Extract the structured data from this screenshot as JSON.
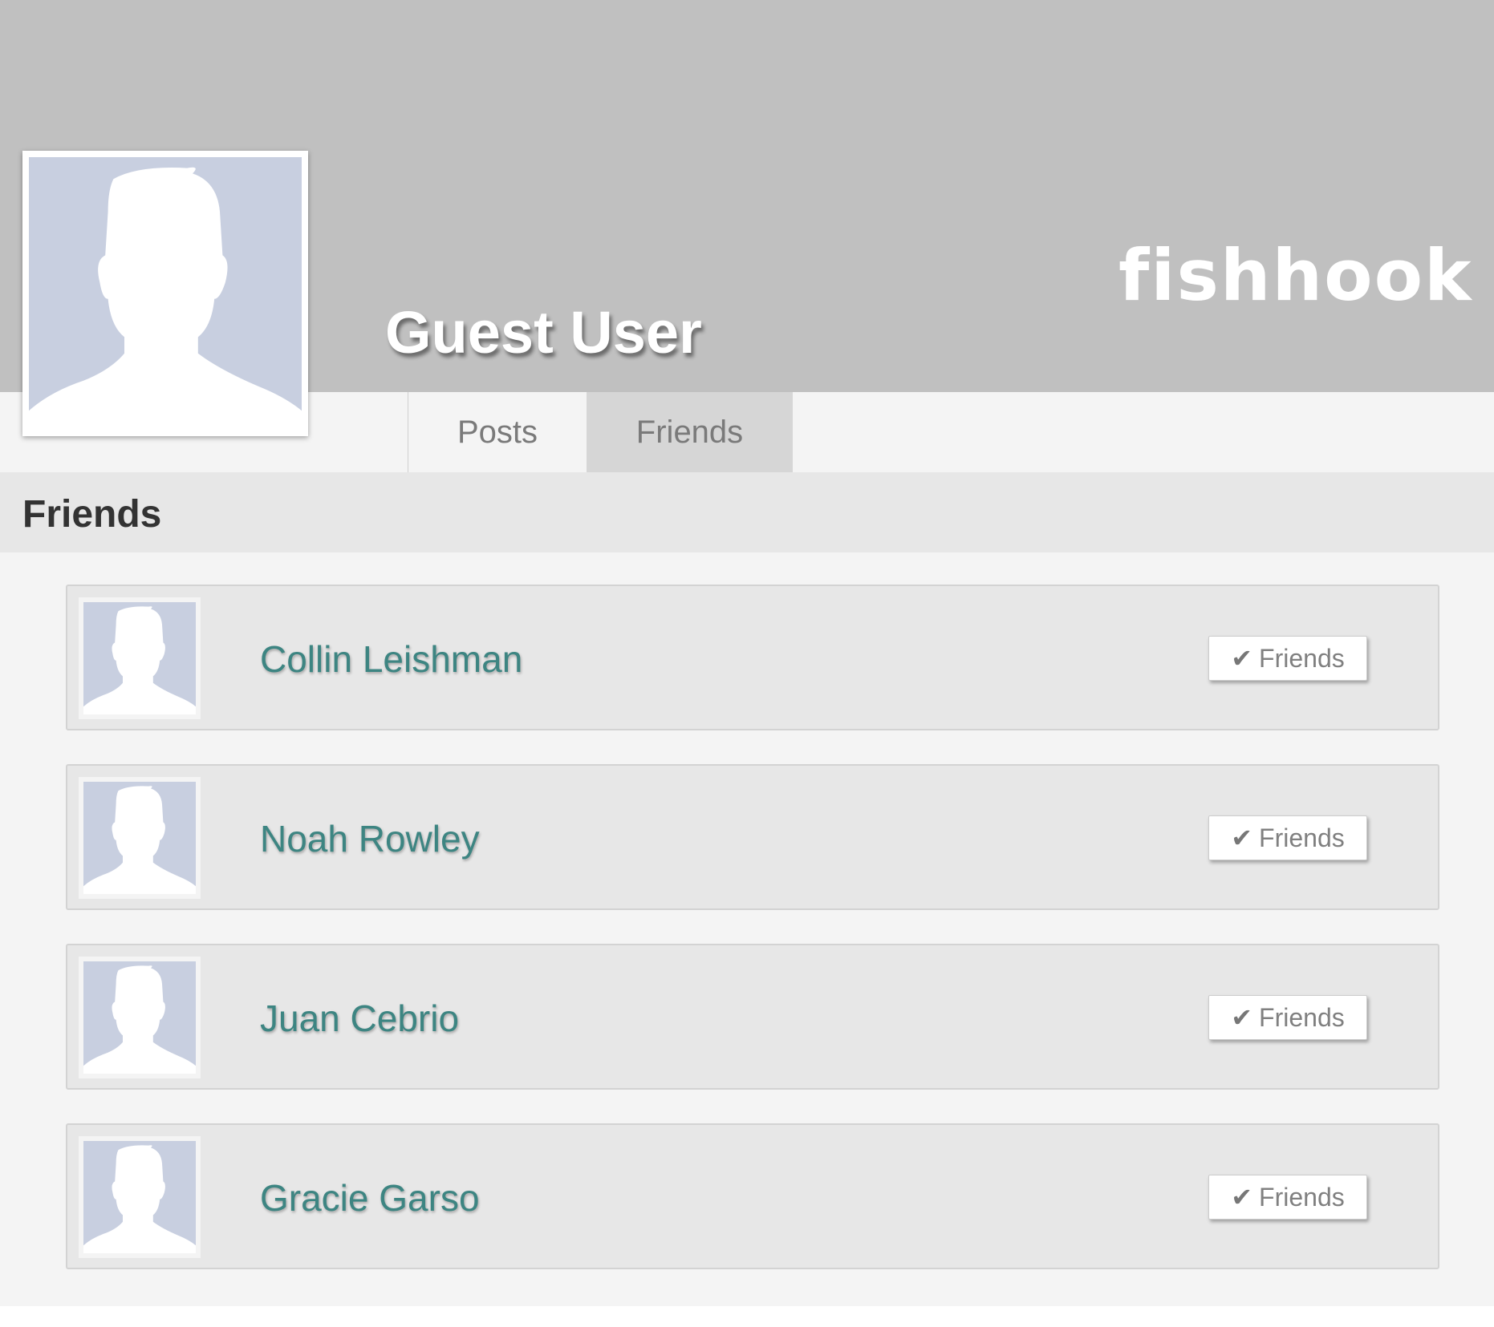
{
  "header": {
    "logo_text": "fishhook",
    "user_name": "Guest User",
    "cover_color": "#c0c0c0"
  },
  "tabs": [
    {
      "label": "Posts",
      "active": false
    },
    {
      "label": "Friends",
      "active": true
    }
  ],
  "section": {
    "title": "Friends"
  },
  "friends": [
    {
      "name": "Collin Leishman",
      "button_label": "Friends",
      "button_icon": "checkmark-icon"
    },
    {
      "name": "Noah Rowley",
      "button_label": "Friends",
      "button_icon": "checkmark-icon"
    },
    {
      "name": "Juan Cebrio",
      "button_label": "Friends",
      "button_icon": "checkmark-icon"
    },
    {
      "name": "Gracie Garso",
      "button_label": "Friends",
      "button_icon": "checkmark-icon"
    }
  ],
  "colors": {
    "friend_name": "#3d8582",
    "avatar_bg": "#c8cfe0"
  },
  "icons": {
    "avatar": "default-avatar-silhouette-icon",
    "check": "✔"
  }
}
